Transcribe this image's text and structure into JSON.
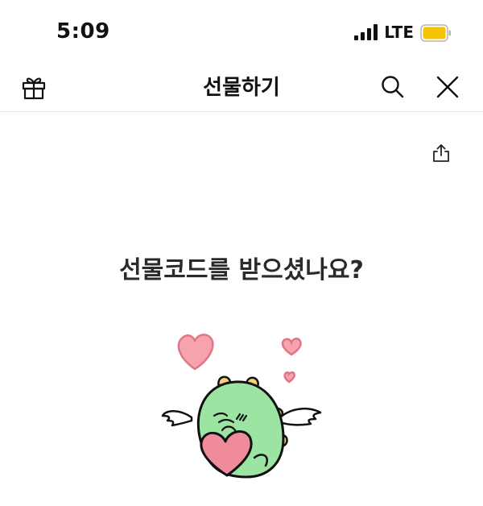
{
  "status_bar": {
    "time": "5:09",
    "network": "LTE",
    "battery_color": "#f5c400"
  },
  "nav": {
    "title": "선물하기",
    "left_icon": "gift-icon",
    "right_icons": [
      "search-icon",
      "close-icon"
    ]
  },
  "content": {
    "share_icon": "share-icon",
    "question": "선물코드를 받으셨나요?",
    "illustration": "green-dinosaur-with-wings-holding-heart"
  },
  "colors": {
    "heart": "#f08b9c",
    "dino": "#9be4a2",
    "text": "#222222"
  }
}
